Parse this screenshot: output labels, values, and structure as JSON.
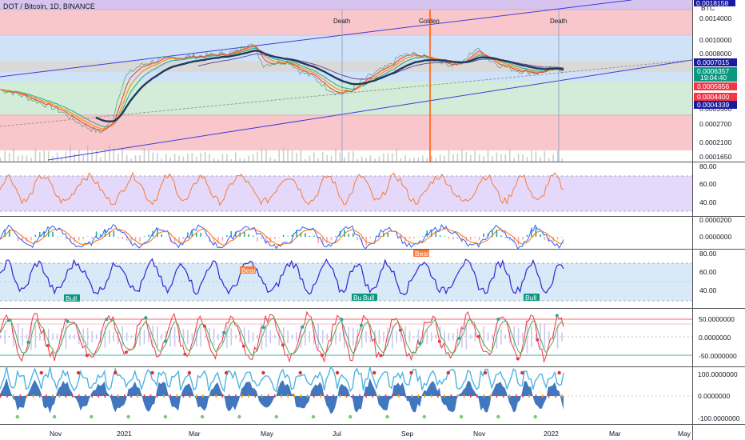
{
  "header": {
    "symbol_title": "DOT / Bitcoin, 1D, BINANCE"
  },
  "colors": {
    "main_line": "#131722",
    "ma_short": "#f23645",
    "ma_medium": "#ff9800",
    "ma_teal": "#26a69a",
    "ma_dark": "#1e3a5f",
    "channel": "#3c3cdc",
    "rsi_line": "#f57c3a",
    "stoch_line": "#2a2ad4",
    "price_tag_green": "#089981",
    "price_tag_red": "#f23645",
    "price_tag_blue": "#2962ff",
    "price_tag_navy": "#1a1aa0",
    "bull_tag": "#089981",
    "bear_tag": "#f57c3a",
    "vertical_cross": "#ff5a00"
  },
  "chart_data": [
    {
      "type": "line",
      "panel": "price",
      "x_tick_labels": [
        "Nov",
        "2021",
        "Mar",
        "May",
        "Jul",
        "Sep",
        "Nov",
        "2022",
        "Mar",
        "May"
      ],
      "y_tick_labels": [
        "0.0014000",
        "0.0010000",
        "0.0008000",
        "0.0006357",
        "0.0005656",
        "0.0004400",
        "0.0003500",
        "0.0002700",
        "0.0002100",
        "0.0001650"
      ],
      "top_tag": "0.0018158",
      "top_tag_sub": "BTC",
      "price_tags": [
        {
          "value": "0.0007015",
          "color_key": "price_tag_navy"
        },
        {
          "value": "0.0006357",
          "sub": "19:04:40",
          "color_key": "price_tag_green"
        },
        {
          "value": "0.0005656",
          "color_key": "price_tag_red"
        },
        {
          "value": "0.0004400",
          "color_key": "price_tag_red"
        },
        {
          "value": "0.0004339",
          "color_key": "price_tag_navy"
        }
      ],
      "annotations": [
        "Death",
        "Golden",
        "Death"
      ],
      "series": [
        {
          "values": [
            0.00048,
            0.00046,
            0.00043,
            0.0004,
            0.00037,
            0.00034,
            0.0003,
            0.00027,
            0.00025,
            0.0003,
            0.00058,
            0.00068,
            0.00073,
            0.00076,
            0.00078,
            0.00079,
            0.0008,
            0.00081,
            0.00083,
            0.00086,
            0.001,
            0.0007,
            0.00072,
            0.00074,
            0.00063,
            0.00058,
            0.0005,
            0.00045,
            0.00047,
            0.00055,
            0.00062,
            0.00068,
            0.0008,
            0.00082,
            0.00078,
            0.00075,
            0.0007,
            0.00072,
            0.0009,
            0.00076,
            0.00069,
            0.00065,
            0.00063,
            0.00062,
            0.00066,
            0.00064
          ]
        }
      ]
    },
    {
      "type": "line",
      "panel": "rsi",
      "y_tick_labels": [
        "80.00",
        "60.00",
        "40.00"
      ],
      "ylim": [
        30,
        85
      ]
    },
    {
      "type": "line",
      "panel": "macd",
      "y_tick_labels": [
        "0.0000200",
        "0.0000000"
      ]
    },
    {
      "type": "line",
      "panel": "stoch_rsi",
      "y_tick_labels": [
        "80.00",
        "60.00",
        "40.00"
      ],
      "ylim": [
        30,
        85
      ],
      "signal_tags": [
        "Bull",
        "Bull",
        "Bear",
        "Bull",
        "Bear",
        "Bull"
      ]
    },
    {
      "type": "line",
      "panel": "oscillator",
      "y_tick_labels": [
        "50.0000000",
        "0.0000000",
        "-50.0000000"
      ]
    },
    {
      "type": "area",
      "panel": "momentum",
      "y_tick_labels": [
        "100.0000000",
        "0.0000000",
        "-100.0000000"
      ]
    }
  ]
}
